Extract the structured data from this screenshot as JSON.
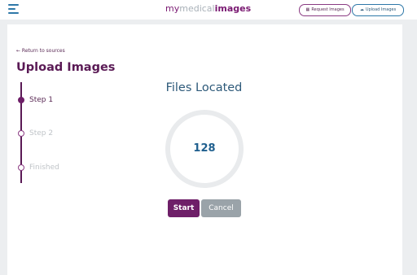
{
  "header": {
    "logo": {
      "my": "my",
      "medical": "medical",
      "images": "images"
    },
    "request_button": {
      "icon": "request-icon",
      "label": "Request Images"
    },
    "upload_button": {
      "icon": "upload-icon",
      "label": "Upload Images"
    }
  },
  "main": {
    "back_link": "← Return to sources",
    "title": "Upload Images",
    "steps": [
      {
        "label": "Step 1",
        "state": "active"
      },
      {
        "label": "Step 2",
        "state": "inactive"
      },
      {
        "label": "Finished",
        "state": "inactive"
      }
    ],
    "files_title": "Files Located",
    "files_count": "128",
    "start_label": "Start",
    "cancel_label": "Cancel"
  },
  "colors": {
    "brand_purple": "#6e1f68",
    "accent_blue": "#2e78a8",
    "ring_gray": "#e9ebed",
    "cancel_gray": "#9aa3a9"
  }
}
